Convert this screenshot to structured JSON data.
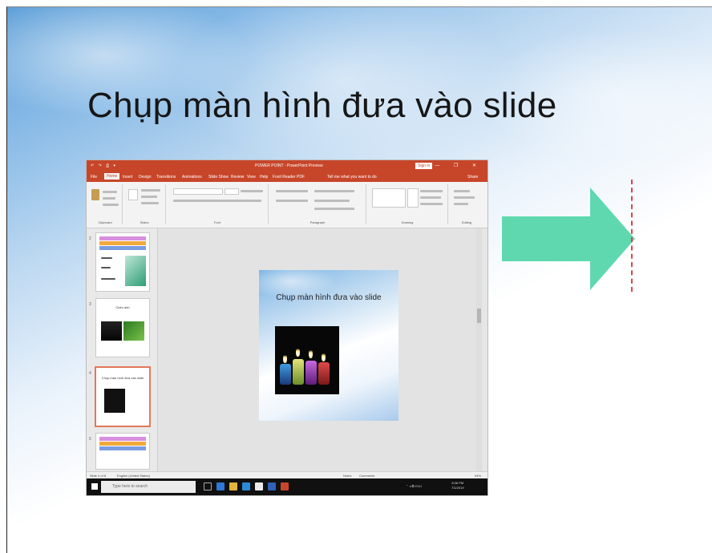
{
  "slide": {
    "title": "Chụp màn hình đưa vào slide"
  },
  "screenshot": {
    "window_title": "POWER POINT - PowerPoint Preview",
    "quick_access": "↶ ↷ ⎙ ▾",
    "sign_in": "Sign in",
    "window_controls": "— ❐ ✕",
    "menu": [
      "File",
      "Home",
      "Insert",
      "Design",
      "Transitions",
      "Animations",
      "Slide Show",
      "Review",
      "View",
      "Help",
      "Foxit Reader PDF"
    ],
    "tell_me": "Tell me what you want to do",
    "share": "Share",
    "ribbon_groups": [
      "Clipboard",
      "Slides",
      "Font",
      "Paragraph",
      "Drawing",
      "Editing"
    ],
    "slide_numbers": [
      "2",
      "3",
      "4",
      "5"
    ],
    "thumb4_title": "Chụp màn hình đưa vào slide",
    "thumb3_title": "Chèn ảnh",
    "main_slide_title": "Chụp màn hình đưa vào slide",
    "status_left": "Slide 4 of 8",
    "status_lang": "English (United States)",
    "status_notes": "Notes",
    "status_comments": "Comments",
    "status_zoom": "54%",
    "search_placeholder": "Type here to search",
    "clock_time": "8:36 PM",
    "clock_date": "7/1/2019",
    "tray_text": "⌃ ◂ ⧉ ENG"
  },
  "colors": {
    "arrow": "#5fd8b0",
    "dashed_line": "#e14343",
    "powerpoint_accent": "#c7462a"
  }
}
